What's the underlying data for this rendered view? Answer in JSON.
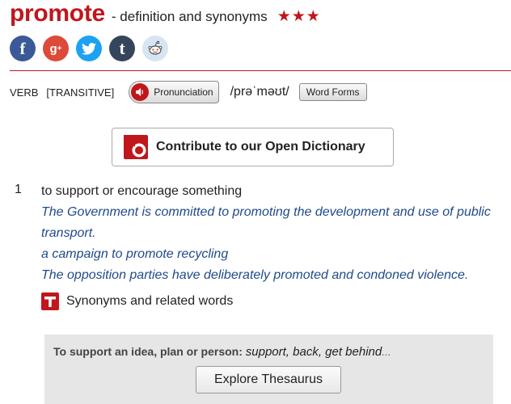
{
  "entry": {
    "headword": "promote",
    "subtitle": "- definition and synonyms",
    "rating_stars": 3
  },
  "social": [
    {
      "name": "facebook-icon",
      "color": "#3b5998"
    },
    {
      "name": "google-plus-icon",
      "color": "#dc4a38"
    },
    {
      "name": "twitter-icon",
      "color": "#1da1f2"
    },
    {
      "name": "tumblr-icon",
      "color": "#35465c"
    },
    {
      "name": "reddit-icon",
      "color": "#d7e5f2"
    }
  ],
  "grammar": {
    "part_of_speech": "VERB",
    "transitivity": "[TRANSITIVE]",
    "pronunciation_label": "Pronunciation",
    "ipa": "/prəˈməʊt/",
    "word_forms_label": "Word Forms"
  },
  "contribute": {
    "label": "Contribute to our Open Dictionary"
  },
  "senses": [
    {
      "number": "1",
      "definition": "to support or encourage something",
      "examples": [
        "The Government is committed to promoting the development and use of public transport.",
        "a campaign to promote recycling",
        "The opposition parties have deliberately promoted and condoned violence."
      ]
    }
  ],
  "synonyms": {
    "label": "Synonyms and related words",
    "lead": "To support an idea, plan or person:",
    "words": "support, back, get behind",
    "ellipsis": "...",
    "explore_label": "Explore Thesaurus"
  },
  "colors": {
    "brand_red": "#c0161c",
    "example_blue": "#1f4a8a",
    "thesaurus_bg": "#e6e6e6"
  }
}
